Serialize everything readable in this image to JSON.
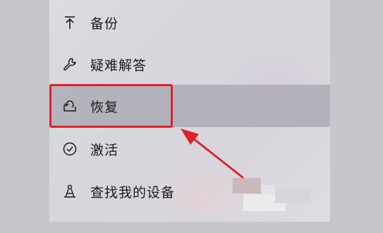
{
  "nav": {
    "items": [
      {
        "label": "备份",
        "icon": "backup-arrow-icon"
      },
      {
        "label": "疑难解答",
        "icon": "wrench-icon"
      },
      {
        "label": "恢复",
        "icon": "recovery-icon",
        "selected": true
      },
      {
        "label": "激活",
        "icon": "check-circle-icon"
      },
      {
        "label": "查找我的设备",
        "icon": "find-device-icon"
      }
    ]
  },
  "annotation": {
    "color": "#e0202a"
  }
}
